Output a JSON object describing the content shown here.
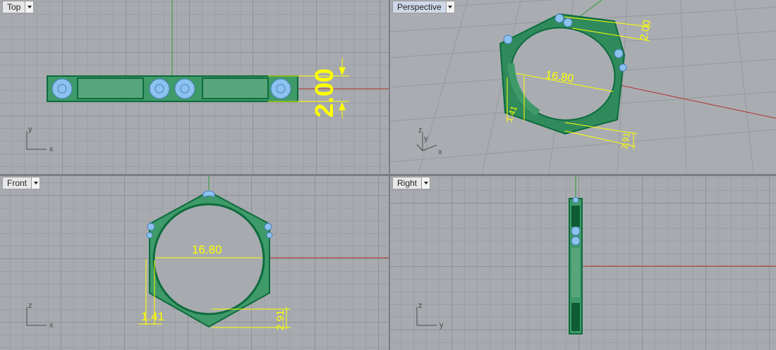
{
  "viewports": {
    "top": {
      "label": "Top"
    },
    "perspective": {
      "label": "Perspective"
    },
    "front": {
      "label": "Front"
    },
    "right": {
      "label": "Right"
    }
  },
  "dimensions": {
    "inner_diameter": "16.80",
    "width": "2.00",
    "thickness": "1.41",
    "flat_height": "2.91"
  },
  "axes": {
    "x": "x",
    "y": "y",
    "z": "z"
  },
  "colors": {
    "viewport_bg": "#a7abb0",
    "ring_fill": "#3f9a6a",
    "ring_edge": "#0d6b3c",
    "dimension": "#ffff00",
    "x_axis": "#b0302a",
    "y_axis": "#2f9a2f",
    "stone": "#8cc2ef"
  },
  "icons": [
    "dropdown-arrow-icon"
  ]
}
